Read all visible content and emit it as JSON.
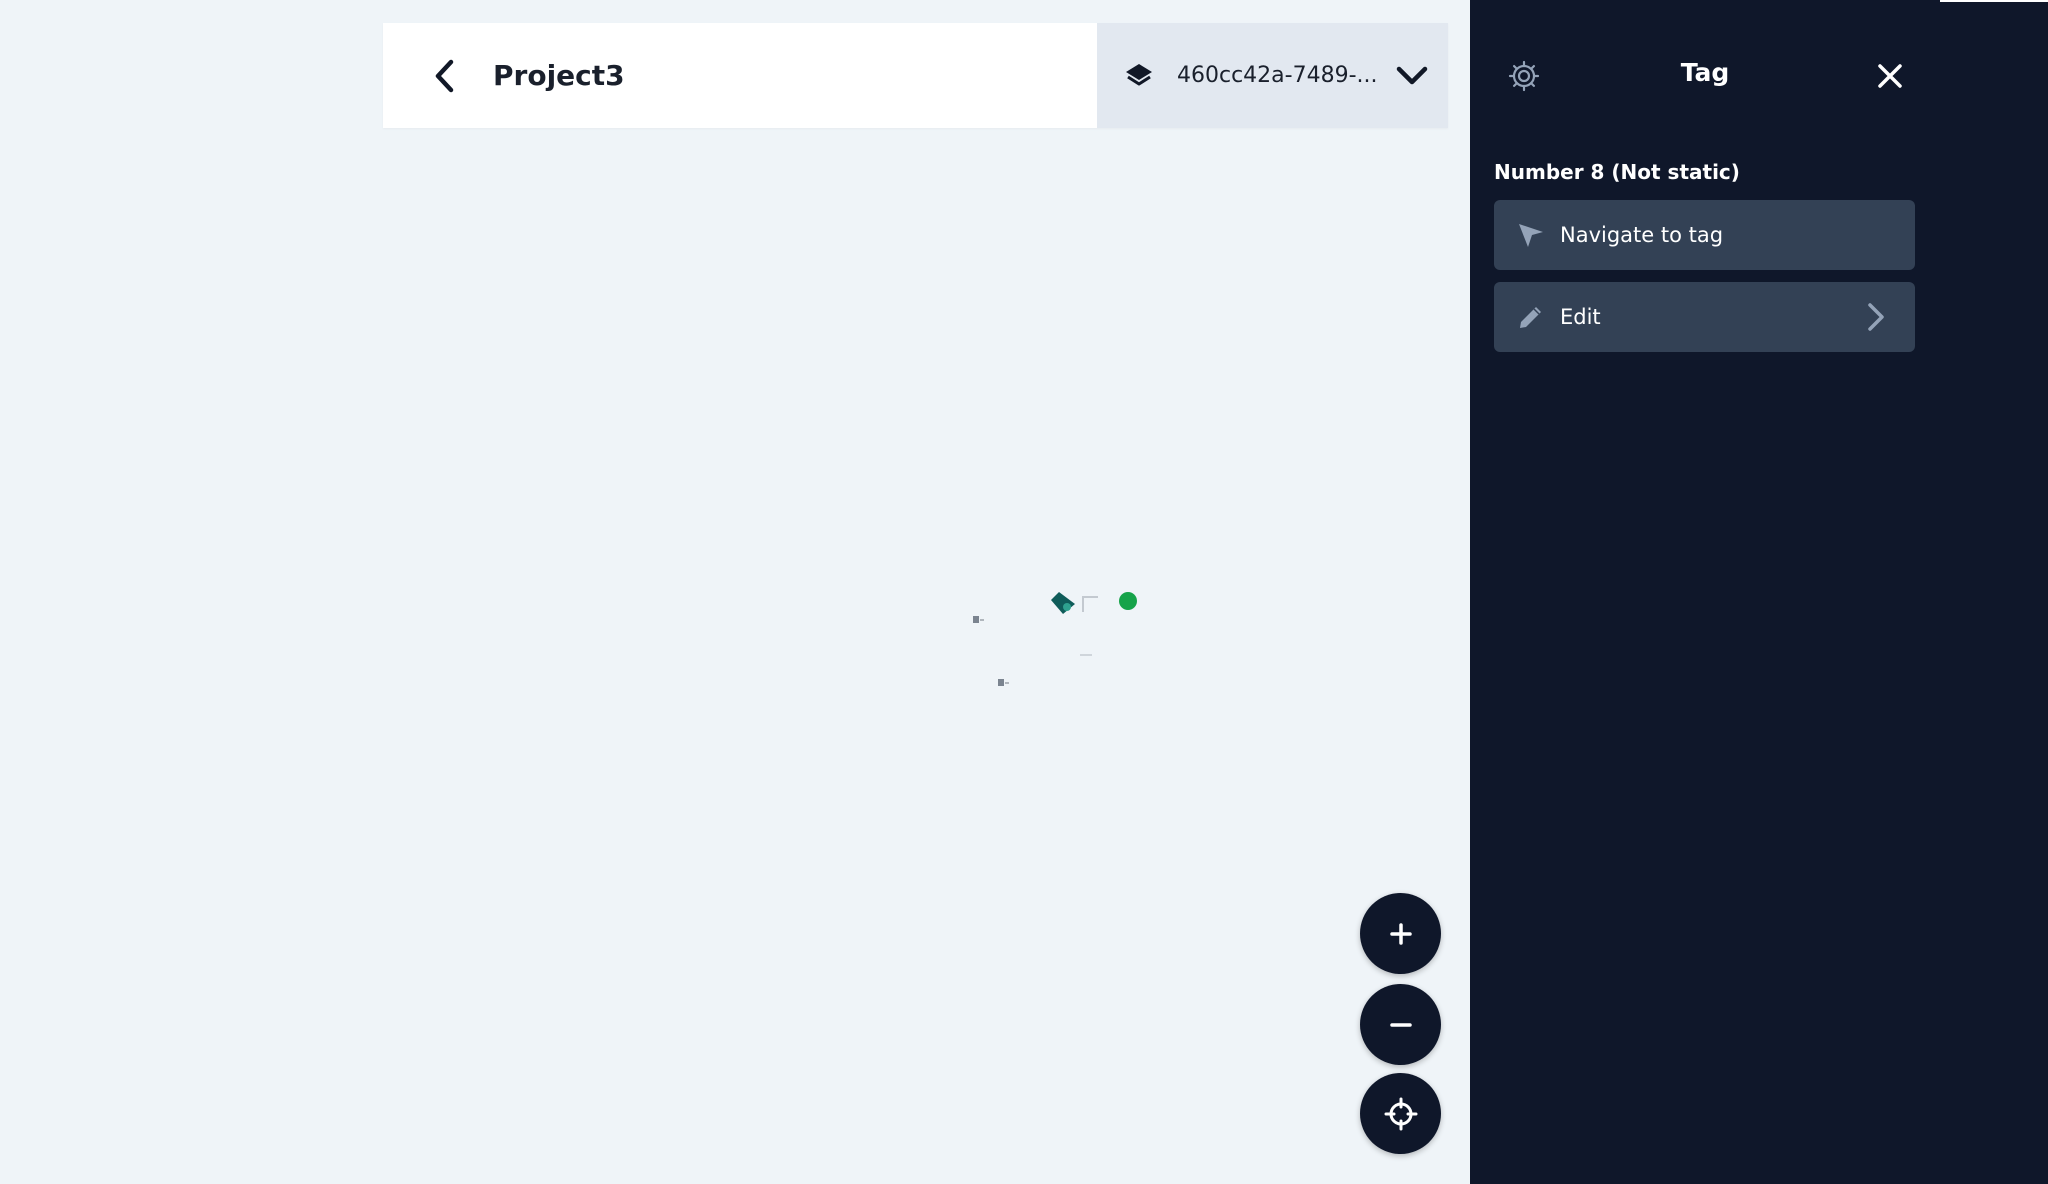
{
  "header": {
    "project_title": "Project3",
    "map_selector": {
      "value": "460cc42a-7489-...",
      "icons": {
        "layers": "layers-icon",
        "dropdown": "chevron-down-icon"
      }
    },
    "back_icon": "chevron-left-icon"
  },
  "map": {
    "colors": {
      "background": "#eff4f8",
      "tag_dot": "#16a34a",
      "tag_marker": "#0f5c5a"
    },
    "controls": {
      "zoom_in_icon": "plus-icon",
      "zoom_out_icon": "minus-icon",
      "recenter_icon": "crosshair-icon"
    }
  },
  "panel": {
    "title": "Tag",
    "settings_icon": "gear-icon",
    "close_icon": "close-icon",
    "tag_name": "Number 8 (Not static)",
    "actions": [
      {
        "label": "Navigate to tag",
        "icon": "navigate-arrow-icon"
      },
      {
        "label": "Edit",
        "icon": "pencil-icon",
        "trailing_icon": "chevron-right-icon"
      }
    ],
    "colors": {
      "background": "#0f172a",
      "action_background": "#334155"
    }
  }
}
